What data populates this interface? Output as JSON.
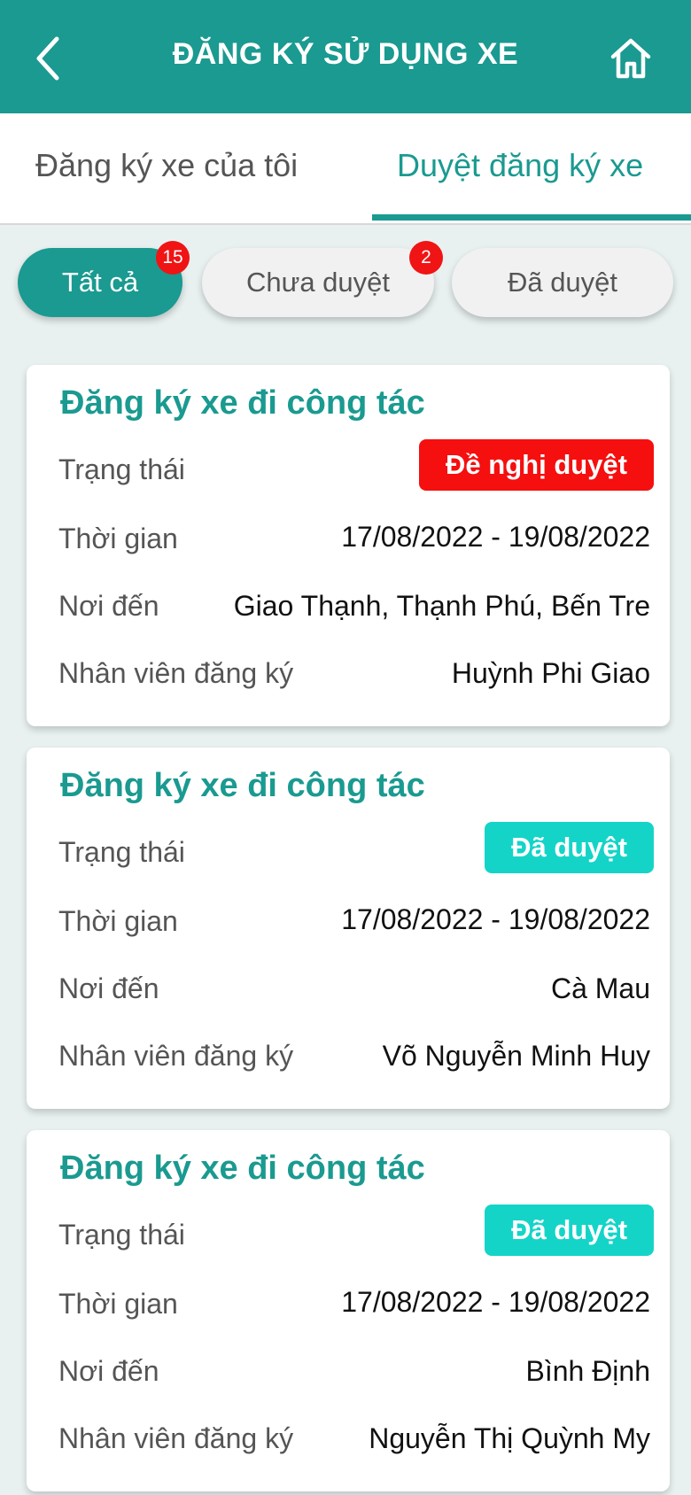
{
  "header": {
    "title": "ĐĂNG KÝ SỬ DỤNG XE",
    "back_icon": "chevron-left-icon",
    "home_icon": "home-icon",
    "color": "#1a9a90"
  },
  "tabs": [
    {
      "label": "Đăng ký xe của tôi",
      "active": false
    },
    {
      "label": "Duyệt đăng ký xe",
      "active": true
    }
  ],
  "filters": [
    {
      "label": "Tất cả",
      "badge": "15",
      "selected": true
    },
    {
      "label": "Chưa duyệt",
      "badge": "2",
      "selected": false
    },
    {
      "label": "Đã duyệt",
      "badge": null,
      "selected": false
    }
  ],
  "labels": {
    "status": "Trạng thái",
    "time": "Thời gian",
    "destination": "Nơi đến",
    "employee": "Nhân viên đăng ký"
  },
  "cards": [
    {
      "title": "Đăng ký xe đi công tác",
      "status": "Đề nghị duyệt",
      "status_color": "#f50f0f",
      "time": "17/08/2022 - 19/08/2022",
      "destination": "Giao Thạnh, Thạnh Phú, Bến Tre",
      "employee": "Huỳnh Phi Giao"
    },
    {
      "title": "Đăng ký xe đi công tác",
      "status": "Đã duyệt",
      "status_color": "#14d4c8",
      "time": "17/08/2022 - 19/08/2022",
      "destination": "Cà Mau",
      "employee": "Võ Nguyễn Minh Huy"
    },
    {
      "title": "Đăng ký xe đi công tác",
      "status": "Đã duyệt",
      "status_color": "#14d4c8",
      "time": "17/08/2022 - 19/08/2022",
      "destination": "Bình Định",
      "employee": "Nguyễn Thị Quỳnh My"
    }
  ]
}
